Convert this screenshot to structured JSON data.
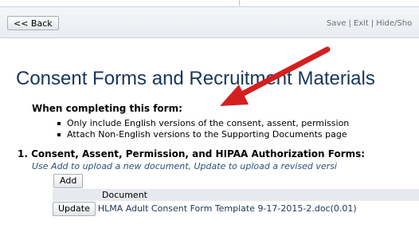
{
  "toolbar": {
    "back_label": "<< Back",
    "links": [
      "Save",
      "Exit",
      "Hide/Sho"
    ]
  },
  "page": {
    "title": "Consent Forms and Recruitment Materials",
    "instructions_heading": "When completing this form:",
    "bullets": [
      "Only include English versions of the consent, assent, permission",
      "Attach Non-English versions to the Supporting Documents page"
    ]
  },
  "section1": {
    "number": "1.",
    "title": "Consent, Assent, Permission, and HIPAA Authorization Forms:",
    "help": "Use Add to upload a new document, Update to upload a revised versi",
    "add_label": "Add",
    "table": {
      "column_header": "Document",
      "rows": [
        {
          "update_label": "Update",
          "document": "HLMA Adult Consent Form Template 9-17-2015-2.doc(0.01)"
        }
      ]
    }
  },
  "colors": {
    "title": "#17365d",
    "arrow": "#d41f1f",
    "help_text": "#2b4f7a"
  }
}
